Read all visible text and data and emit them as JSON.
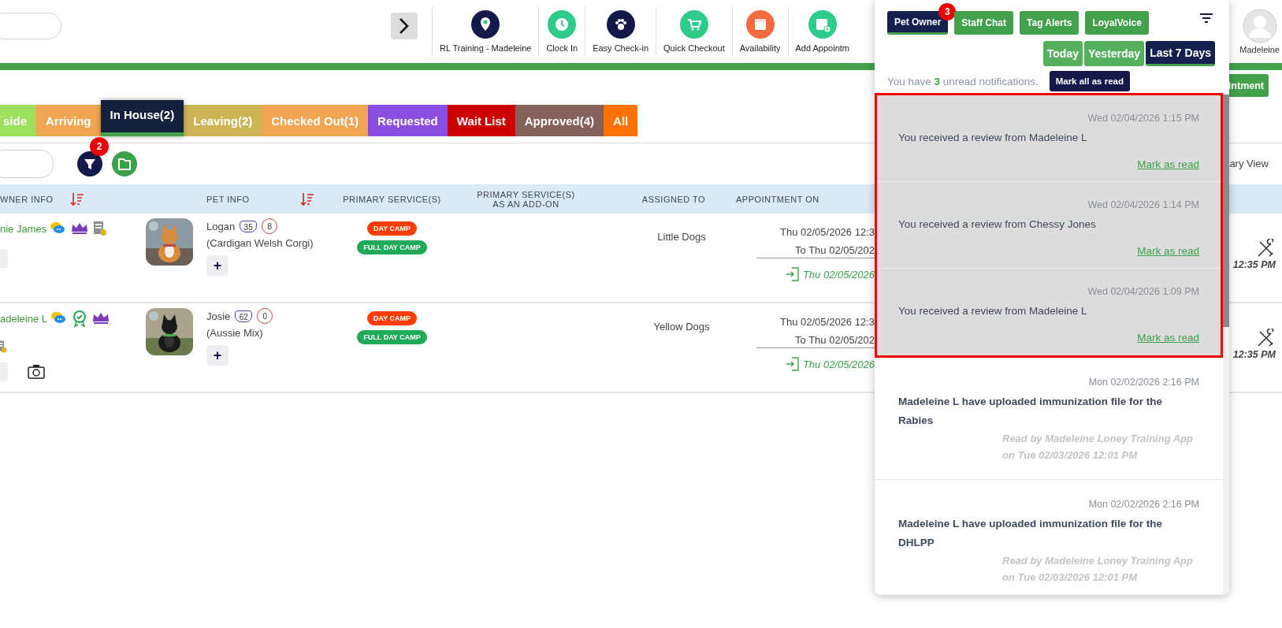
{
  "toolbar": {
    "items": [
      {
        "label": "RL Training - Madeleine",
        "kind": "pin",
        "color": "#15194a"
      },
      {
        "label": "Clock In",
        "kind": "clock",
        "color": "#2ecc8a"
      },
      {
        "label": "Easy Check-in",
        "kind": "paw",
        "color": "#15194a"
      },
      {
        "label": "Quick Checkout",
        "kind": "cart",
        "color": "#2ecc8a"
      },
      {
        "label": "Availability",
        "kind": "calendar",
        "color": "#f26a3d"
      },
      {
        "label": "Add Appointm",
        "kind": "calendar-add",
        "color": "#2ecc8a"
      }
    ],
    "user": {
      "name": "Madeleine"
    }
  },
  "action_button": {
    "label": "intment"
  },
  "status_tabs": [
    {
      "label": "side",
      "color": "#9be15d",
      "selected": false
    },
    {
      "label": "Arriving",
      "color": "#f0a550",
      "selected": false
    },
    {
      "label": "In House(2)",
      "color": "#15213d",
      "selected": true
    },
    {
      "label": "Leaving(2)",
      "color": "#cdb556",
      "selected": false
    },
    {
      "label": "Checked Out(1)",
      "color": "#f0a550",
      "selected": false
    },
    {
      "label": "Requested",
      "color": "#8a4fe0",
      "selected": false
    },
    {
      "label": "Wait List",
      "color": "#cc0000",
      "selected": false
    },
    {
      "label": "Approved(4)",
      "color": "#86605a",
      "selected": false
    },
    {
      "label": "All",
      "color": "#ff7200",
      "selected": false
    }
  ],
  "filter_badge": "2",
  "view_toggle": {
    "label": "ary View"
  },
  "table": {
    "columns": [
      {
        "label": "WNER INFO",
        "sortable": true
      },
      {
        "sortable": false
      },
      {
        "label": "PET INFO",
        "sortable": true
      },
      {
        "label": "PRIMARY SERVICE(S)",
        "sortable": false
      },
      {
        "label": "PRIMARY SERVICE(S)\nAS AN ADD-ON",
        "sortable": false
      },
      {
        "label": "ASSIGNED TO",
        "sortable": false
      },
      {
        "label": "APPOINTMENT ON",
        "sortable": false
      }
    ],
    "rows": [
      {
        "owner": "nie James",
        "owner_icons": [
          {
            "kind": "chat"
          },
          {
            "kind": "crown"
          },
          {
            "kind": "document"
          }
        ],
        "photo": {
          "kind": "picture"
        },
        "add_button": "+",
        "pet_name": "Logan",
        "weight": "35",
        "visits": "8",
        "breed": "(Cardigan Welsh Corgi)",
        "services": [
          {
            "label": "DAY CAMP",
            "color": "#ff3d00"
          },
          {
            "label": "FULL DAY CAMP",
            "color": "#1faa59"
          }
        ],
        "assigned": "Little Dogs",
        "appointment_start": "Thu 02/05/2026 12:3",
        "appointment_end": "To Thu 02/05/202",
        "checked_in": "Thu 02/05/2026",
        "time": "12:35 PM"
      },
      {
        "owner": "adeleine L",
        "owner_icons": [
          {
            "kind": "chat"
          },
          {
            "kind": "award"
          },
          {
            "kind": "crown"
          }
        ],
        "owner_icons_below": [
          {
            "kind": "document"
          }
        ],
        "tool_icons": [
          {
            "kind": "camera"
          }
        ],
        "photo": {
          "kind": "picture"
        },
        "add_button": "+",
        "pet_name": "Josie",
        "weight": "62",
        "visits": "0",
        "breed": "(Aussie Mix)",
        "services": [
          {
            "label": "DAY CAMP",
            "color": "#ff3d00"
          },
          {
            "label": "FULL DAY CAMP",
            "color": "#1faa59"
          }
        ],
        "assigned": "Yellow Dogs",
        "appointment_start": "Thu 02/05/2026 12:3",
        "appointment_end": "To Thu 02/05/202",
        "checked_in": "Thu 02/05/2026",
        "time": "12:35 PM"
      }
    ]
  },
  "notification_panel": {
    "tabs": [
      {
        "label": "Pet Owner",
        "selected": true,
        "badge": "3"
      },
      {
        "label": "Staff Chat",
        "selected": false
      },
      {
        "label": "Tag Alerts",
        "selected": false
      },
      {
        "label": "LoyalVoice",
        "selected": false
      }
    ],
    "date_filters": [
      {
        "label": "Today",
        "selected": false
      },
      {
        "label": "Yesterday",
        "selected": false
      },
      {
        "label": "Last 7 Days",
        "selected": true
      }
    ],
    "summary": {
      "before": "You have",
      "count": "3",
      "after": "unread notifications."
    },
    "mark_all_button": "Mark all as read",
    "notifications": [
      {
        "unread": true,
        "time": "Wed 02/04/2026 1:15 PM",
        "message": "You received a review from Madeleine L",
        "action": "Mark as read"
      },
      {
        "unread": true,
        "time": "Wed 02/04/2026 1:14 PM",
        "message": "You received a review from Chessy Jones",
        "action": "Mark as read"
      },
      {
        "unread": true,
        "time": "Wed 02/04/2026 1:09 PM",
        "message": "You received a review from Madeleine L",
        "action": "Mark as read"
      },
      {
        "unread": false,
        "time": "Mon 02/02/2026 2:16 PM",
        "message": "Madeleine L have uploaded immunization file for the Rabies",
        "read_by": [
          "Read by Madeleine Loney Training App",
          "on Tue 02/03/2026 12:01 PM"
        ]
      },
      {
        "unread": false,
        "time": "Mon 02/02/2026 2:16 PM",
        "message": "Madeleine L have uploaded immunization file for the DHLPP",
        "read_by": [
          "Read by Madeleine Loney Training App",
          "on Tue 02/03/2026 12:01 PM"
        ]
      }
    ]
  }
}
